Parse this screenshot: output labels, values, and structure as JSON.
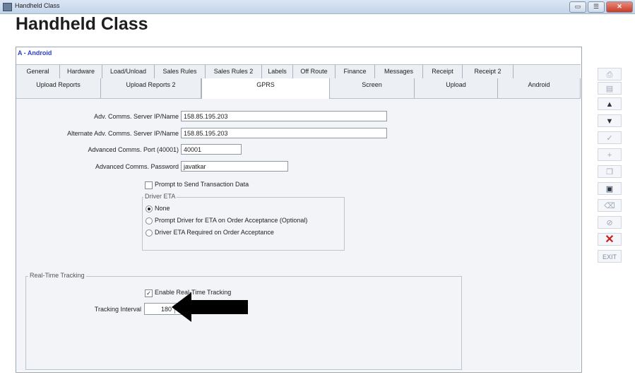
{
  "window": {
    "title": "Handheld Class",
    "minimize_icon": "minimize-icon",
    "maximize_icon": "maximize-icon",
    "close_label": "✕"
  },
  "page": {
    "heading": "Handheld Class",
    "module_label": "A - Android"
  },
  "tabs_row1": [
    {
      "label": "General"
    },
    {
      "label": "Hardware"
    },
    {
      "label": "Load/Unload"
    },
    {
      "label": "Sales Rules"
    },
    {
      "label": "Sales Rules 2"
    },
    {
      "label": "Labels"
    },
    {
      "label": "Off Route"
    },
    {
      "label": "Finance"
    },
    {
      "label": "Messages"
    },
    {
      "label": "Receipt"
    },
    {
      "label": "Receipt 2"
    }
  ],
  "tabs_row2": [
    {
      "label": "Upload Reports"
    },
    {
      "label": "Upload Reports 2"
    },
    {
      "label": "GPRS",
      "active": true
    },
    {
      "label": "Screen"
    },
    {
      "label": "Upload"
    },
    {
      "label": "Android"
    }
  ],
  "form": {
    "server_label": "Adv. Comms. Server IP/Name",
    "server_value": "158.85.195.203",
    "alt_server_label": "Alternate Adv. Comms. Server IP/Name",
    "alt_server_value": "158.85.195.203",
    "port_label": "Advanced Comms. Port (40001)",
    "port_value": "40001",
    "password_label": "Advanced Comms. Password",
    "password_value": "javatkar",
    "prompt_send_label": "Prompt to Send Transaction Data",
    "prompt_send_checked": false,
    "driver_eta": {
      "legend": "Driver ETA",
      "options": [
        {
          "label": "None",
          "selected": true
        },
        {
          "label": "Prompt Driver for ETA on Order Acceptance (Optional)",
          "selected": false
        },
        {
          "label": "Driver ETA Required on Order Acceptance",
          "selected": false
        }
      ]
    },
    "tracking": {
      "legend": "Real-Time Tracking",
      "enable_label": "Enable Real-Time Tracking",
      "enable_checked": true,
      "interval_label": "Tracking Interval",
      "interval_value": "180"
    }
  },
  "sidebar": [
    {
      "name": "print-icon",
      "glyph": "⎙"
    },
    {
      "name": "list-icon",
      "glyph": "▤"
    },
    {
      "name": "up-arrow-icon",
      "glyph": "▲"
    },
    {
      "name": "down-arrow-icon",
      "glyph": "▼"
    },
    {
      "name": "checkmark-icon",
      "glyph": "✓"
    },
    {
      "name": "add-icon",
      "glyph": "+"
    },
    {
      "name": "copy-icon",
      "glyph": "❐"
    },
    {
      "name": "save-icon",
      "glyph": "▣"
    },
    {
      "name": "delete-icon",
      "glyph": "⌫"
    },
    {
      "name": "cancel-icon",
      "glyph": "⊘"
    },
    {
      "name": "close-x-icon",
      "glyph": "✕"
    },
    {
      "name": "exit-button",
      "glyph": "EXIT"
    }
  ],
  "colors": {
    "accent": "#2a3fd0",
    "close_x": "#d11a1a"
  }
}
